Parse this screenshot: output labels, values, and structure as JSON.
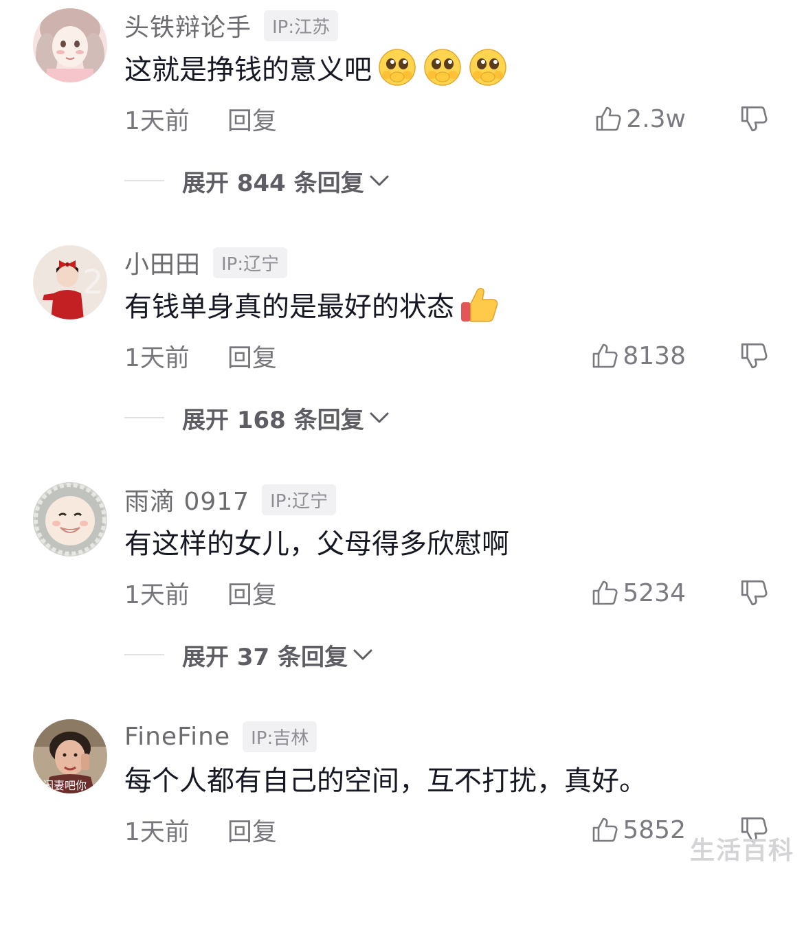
{
  "comments": [
    {
      "username": "头铁辩论手",
      "ip": "IP:江苏",
      "text": "这就是挣钱的意义吧",
      "emojis": [
        "pleading-face-icon",
        "pleading-face-icon",
        "pleading-face-icon"
      ],
      "time": "1天前",
      "reply": "回复",
      "likes": "2.3w",
      "expand": "展开 844 条回复"
    },
    {
      "username": "小田田",
      "ip": "IP:辽宁",
      "text": "有钱单身真的是最好的状态",
      "emojis": [
        "thumbs-up-emoji-icon"
      ],
      "time": "1天前",
      "reply": "回复",
      "likes": "8138",
      "expand": "展开 168 条回复"
    },
    {
      "username": "雨滴 0917",
      "ip": "IP:辽宁",
      "text": "有这样的女儿，父母得多欣慰啊",
      "emojis": [],
      "time": "1天前",
      "reply": "回复",
      "likes": "5234",
      "expand": "展开 37 条回复"
    },
    {
      "username": "FineFine",
      "ip": "IP:吉林",
      "text": "每个人都有自己的空间，互不打扰，真好。",
      "emojis": [],
      "time": "1天前",
      "reply": "回复",
      "likes": "5852",
      "avatar_overlay_text": "闲妻吧你"
    }
  ],
  "watermark": "生活百科",
  "colors": {
    "text_primary": "#161823",
    "text_secondary": "#77777d",
    "badge_bg": "#f1f1f3",
    "expand_text": "#5d5d63"
  }
}
